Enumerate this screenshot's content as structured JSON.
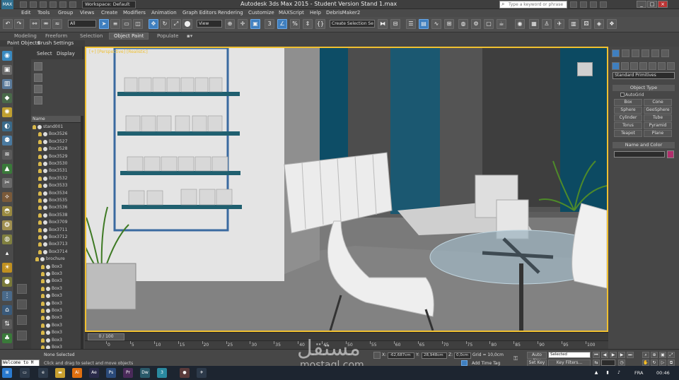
{
  "titlebar": {
    "workspace": "Workspace: Default",
    "title": "Autodesk 3ds Max  2015   -  Student Version   Stand 1.max",
    "search_placeholder": "Type a keyword or phrase"
  },
  "menu": [
    "Edit",
    "Tools",
    "Group",
    "Views",
    "Create",
    "Modifiers",
    "Animation",
    "Graph Editors",
    "Rendering",
    "Customize",
    "MAXScript",
    "Help",
    "DebrisMaker2"
  ],
  "toolbar": {
    "selection_filter": "All",
    "ref_coord": "View",
    "named_selection": "Create Selection Se"
  },
  "ribbon": {
    "tabs": [
      "Modeling",
      "Freeform",
      "Selection",
      "Object Paint",
      "Populate"
    ],
    "active_tab": "Object Paint",
    "sub": [
      "Paint Objects",
      "Brush Settings"
    ]
  },
  "scene_explorer": {
    "tabs": [
      "Select",
      "Display"
    ],
    "column_header": "Name",
    "root": "stand001",
    "items": [
      "Box3526",
      "Box3527",
      "Box3528",
      "Box3529",
      "Box3530",
      "Box3531",
      "Box3532",
      "Box3533",
      "Box3534",
      "Box3535",
      "Box3536",
      "Box3538",
      "Box3709",
      "Box3711",
      "Box3712",
      "Box3713",
      "Box3714"
    ],
    "group": "brochure",
    "group_items": [
      "Box3",
      "Box3",
      "Box3",
      "Box3",
      "Box3",
      "Box3",
      "Box3",
      "Box3",
      "Box3",
      "Box3",
      "Box3",
      "Box3",
      "Box3",
      "Box3",
      "Box3"
    ]
  },
  "viewport": {
    "label": "[+] [Perspective] [Realistic]"
  },
  "command_panel": {
    "category": "Standard Primitives",
    "object_type_title": "Object Type",
    "autogrid": "AutoGrid",
    "primitives": [
      "Box",
      "Cone",
      "Sphere",
      "GeoSphere",
      "Cylinder",
      "Tube",
      "Torus",
      "Pyramid",
      "Teapot",
      "Plane"
    ],
    "name_color_title": "Name and Color",
    "color": "#b0306c"
  },
  "timeline": {
    "frame_indicator": "0 / 100",
    "ticks": [
      "0",
      "5",
      "10",
      "15",
      "20",
      "25",
      "30",
      "35",
      "40",
      "45",
      "50",
      "55",
      "60",
      "65",
      "70",
      "75",
      "80",
      "85",
      "90",
      "95",
      "100"
    ]
  },
  "status": {
    "maxscript_text": "Welcome to M",
    "selection_info": "None Selected",
    "prompt": "Click and drag to select and move objects",
    "x_label": "X:",
    "x_value": "-62,687cm",
    "y_label": "Y:",
    "y_value": "28,948cm",
    "z_label": "Z:",
    "z_value": "0,0cm",
    "grid": "Grid = 10,0cm",
    "add_time_tag": "Add Time Tag",
    "auto_key": "Auto Key",
    "set_key": "Set Key",
    "key_mode": "Selected",
    "key_filters": "Key Filters..."
  },
  "taskbar": {
    "language": "FRA",
    "time": "00:46"
  },
  "watermark": {
    "arabic": "مستقل",
    "latin": "mostaql.com"
  }
}
